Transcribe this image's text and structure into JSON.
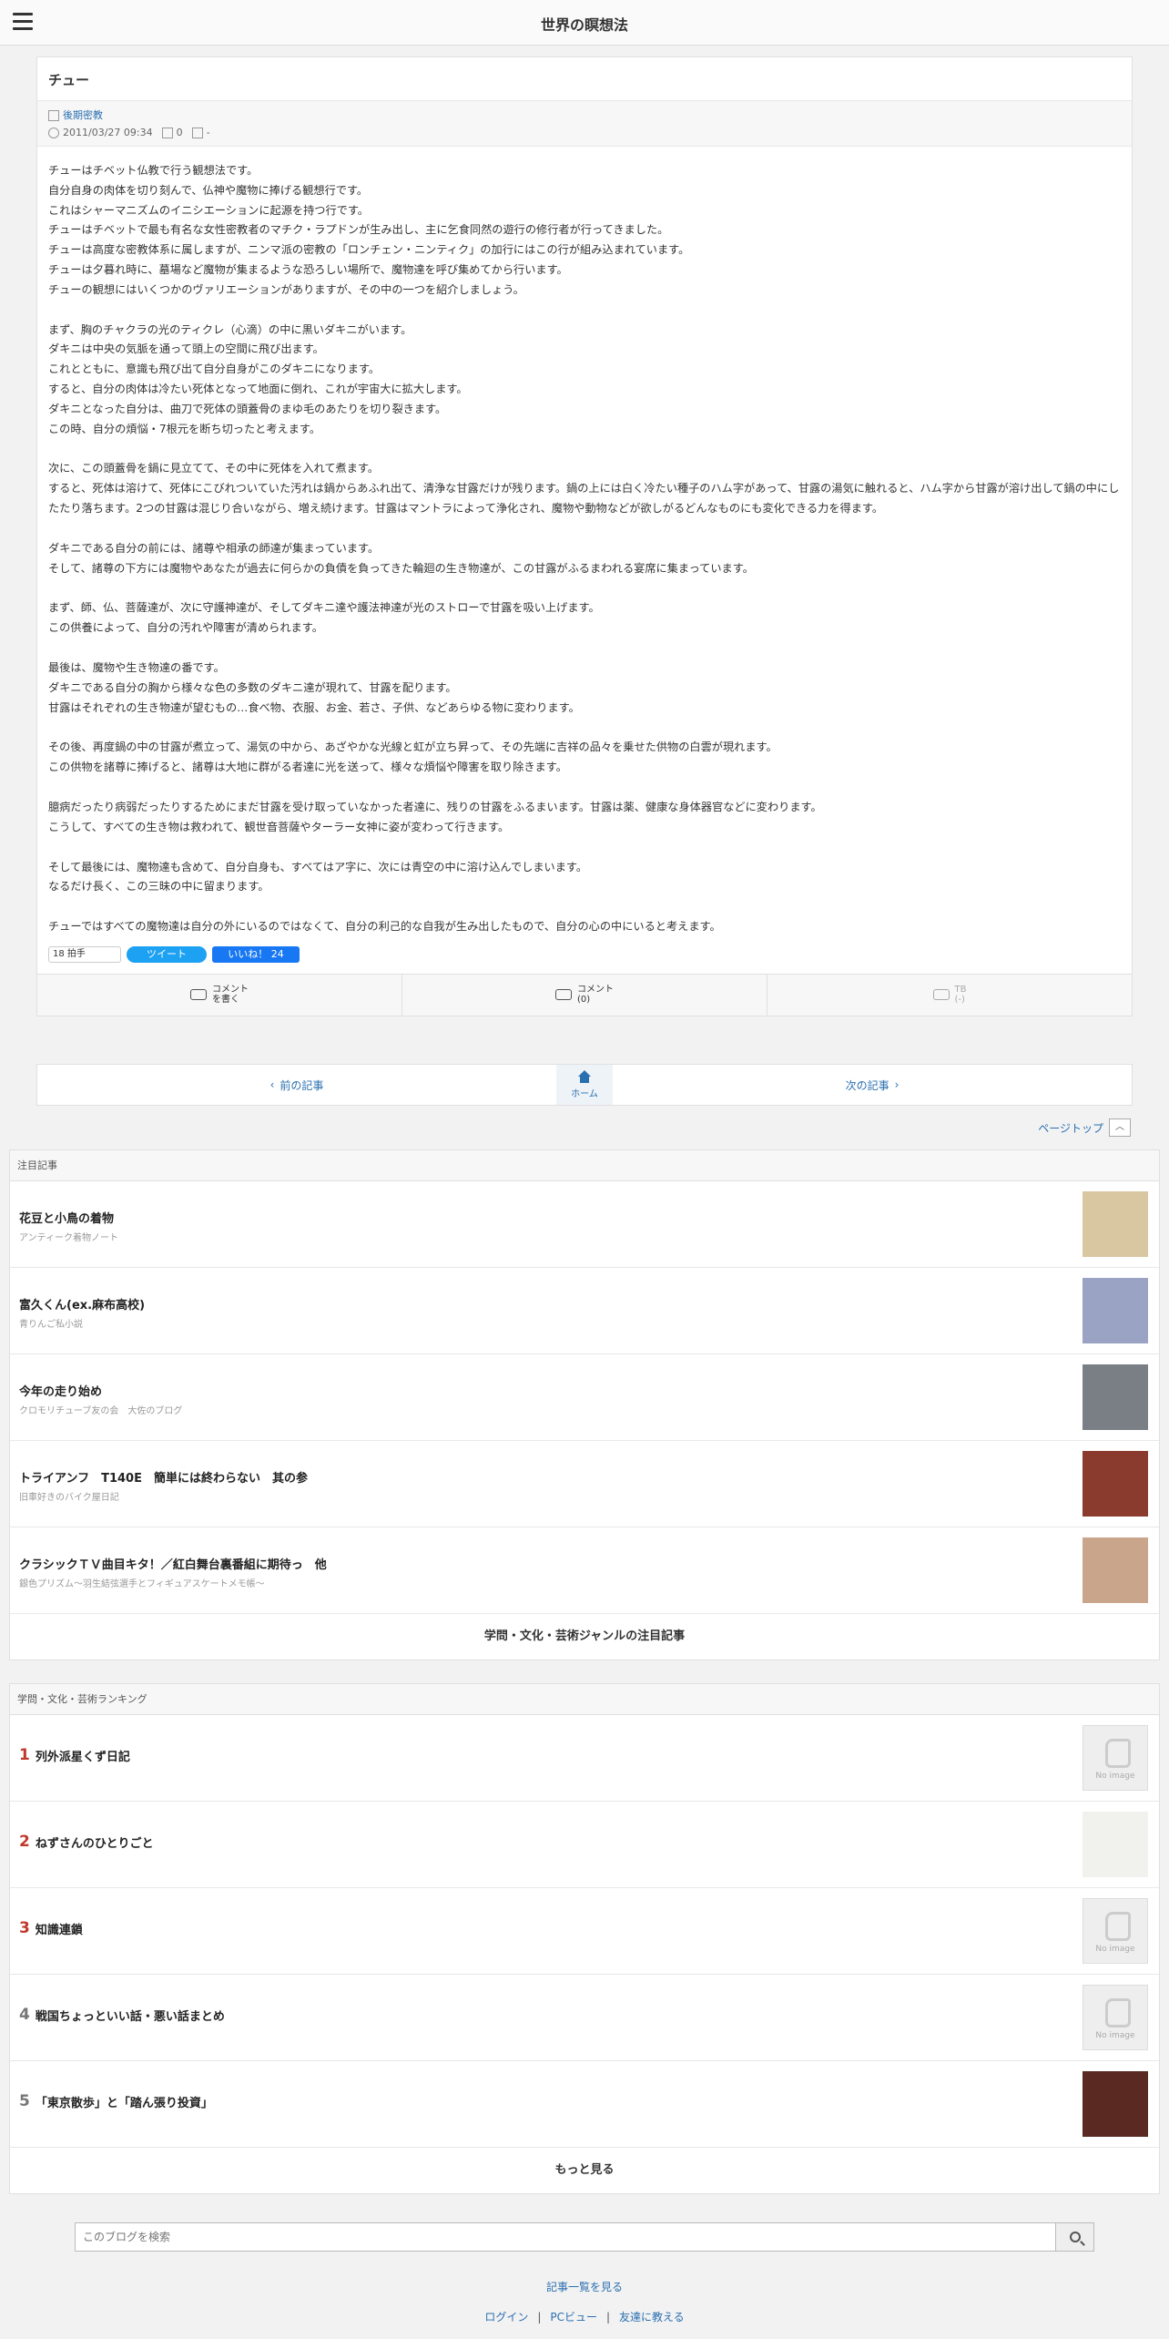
{
  "header": {
    "blog_title": "世界の瞑想法"
  },
  "article": {
    "title": "チュー",
    "category": "後期密教",
    "datetime": "2011/03/27 09:34",
    "comment_count": "0",
    "tb_count": "-",
    "paragraphs": [
      "チューはチベット仏教で行う観想法です。\n自分自身の肉体を切り刻んで、仏神や魔物に捧げる観想行です。\nこれはシャーマニズムのイニシエーションに起源を持つ行です。\nチューはチベットで最も有名な女性密教者のマチク・ラプドンが生み出し、主に乞食同然の遊行の修行者が行ってきました。\nチューは高度な密教体系に属しますが、ニンマ派の密教の「ロンチェン・ニンティク」の加行にはこの行が組み込まれています。\nチューは夕暮れ時に、墓場など魔物が集まるような恐ろしい場所で、魔物達を呼び集めてから行います。\nチューの観想にはいくつかのヴァリエーションがありますが、その中の一つを紹介しましょう。",
      "まず、胸のチャクラの光のティクレ（心滴）の中に黒いダキニがいます。\nダキニは中央の気脈を通って頭上の空間に飛び出ます。\nこれとともに、意識も飛び出て自分自身がこのダキニになります。\nすると、自分の肉体は冷たい死体となって地面に倒れ、これが宇宙大に拡大します。\nダキニとなった自分は、曲刀で死体の頭蓋骨のまゆ毛のあたりを切り裂きます。\nこの時、自分の煩悩・7根元を断ち切ったと考えます。",
      "次に、この頭蓋骨を鍋に見立てて、その中に死体を入れて煮ます。\nすると、死体は溶けて、死体にこびれついていた汚れは鍋からあふれ出て、清浄な甘露だけが残ります。鍋の上には白く冷たい種子のハム字があって、甘露の湯気に触れると、ハム字から甘露が溶け出して鍋の中にしたたり落ちます。2つの甘露は混じり合いながら、増え続けます。甘露はマントラによって浄化され、魔物や動物などが欲しがるどんなものにも変化できる力を得ます。",
      "ダキニである自分の前には、諸尊や相承の師達が集まっています。\nそして、諸尊の下方には魔物やあなたが過去に何らかの負債を負ってきた輪廻の生き物達が、この甘露がふるまわれる宴席に集まっています。",
      "まず、師、仏、菩薩達が、次に守護神達が、そしてダキニ達や護法神達が光のストローで甘露を吸い上げます。\nこの供養によって、自分の汚れや障害が清められます。",
      "最後は、魔物や生き物達の番です。\nダキニである自分の胸から様々な色の多数のダキニ達が現れて、甘露を配ります。\n甘露はそれぞれの生き物達が望むもの…食べ物、衣服、お金、若さ、子供、などあらゆる物に変わります。",
      "その後、再度鍋の中の甘露が煮立って、湯気の中から、あざやかな光線と虹が立ち昇って、その先端に吉祥の品々を乗せた供物の白雲が現れます。\nこの供物を諸尊に捧げると、諸尊は大地に群がる者達に光を送って、様々な煩悩や障害を取り除きます。",
      "臆病だったり病弱だったりするためにまだ甘露を受け取っていなかった者達に、残りの甘露をふるまいます。甘露は薬、健康な身体器官などに変わります。\nこうして、すべての生き物は救われて、観世音菩薩やターラー女神に姿が変わって行きます。",
      "そして最後には、魔物達も含めて、自分自身も、すべてはア字に、次には青空の中に溶け込んでしまいます。\nなるだけ長く、この三昧の中に留まります。",
      "チューではすべての魔物達は自分の外にいるのではなくて、自分の利己的な自我が生み出したもので、自分の心の中にいると考えます。"
    ]
  },
  "share": {
    "hatena_label": "18 拍手",
    "tweet_label": "ツイート",
    "like_label": "いいね！ 24"
  },
  "actions": {
    "write_comment": "コメント\nを書く",
    "comments": "コメント\n(0)",
    "tb": "TB\n(-)"
  },
  "pager": {
    "prev": "前の記事",
    "home": "ホーム",
    "next": "次の記事"
  },
  "pagetop": {
    "label": "ページトップ"
  },
  "featured": {
    "heading": "注目記事",
    "items": [
      {
        "title": "花豆と小鳥の着物",
        "blog": "アンティーク着物ノート",
        "thumb_color": "#d8c7a0"
      },
      {
        "title": "富久くん(ex.麻布高校)",
        "blog": "青りんご私小説",
        "thumb_color": "#9aa3c4"
      },
      {
        "title": "今年の走り始め",
        "blog": "クロモリチューブ友の会　大佐のブログ",
        "thumb_color": "#7a7f86"
      },
      {
        "title": "トライアンフ　T140E　簡単には終わらない　其の参",
        "blog": "旧車好きのバイク屋日記",
        "thumb_color": "#8a3b2e"
      },
      {
        "title": "クラシックＴＶ曲目キタ！／紅白舞台裏番組に期待っ　他",
        "blog": "銀色プリズム～羽生結弦選手とフィギュアスケートメモ帳～",
        "thumb_color": "#c9a58c"
      }
    ],
    "footer": "学問・文化・芸術ジャンルの注目記事"
  },
  "ranking": {
    "heading": "学問・文化・芸術ランキング",
    "items": [
      {
        "rank": "1",
        "title": "列外派星くず日記",
        "no_image": "No image",
        "rank_color": "#c0392b"
      },
      {
        "rank": "2",
        "title": "ねずさんのひとりごと",
        "no_image": "",
        "rank_color": "#c0392b"
      },
      {
        "rank": "3",
        "title": "知識連鎖",
        "no_image": "No image",
        "rank_color": "#c0392b"
      },
      {
        "rank": "4",
        "title": "戦国ちょっといい話・悪い話まとめ",
        "no_image": "No image",
        "rank_color": "#777777"
      },
      {
        "rank": "5",
        "title": "「東京散歩」と「踏ん張り投資」",
        "no_image": "",
        "rank_color": "#777777"
      }
    ],
    "footer": "もっと見る"
  },
  "search": {
    "placeholder": "このブログを検索"
  },
  "footer": {
    "article_list": "記事一覧を見る",
    "login": "ログイン",
    "pc_view": "PCビュー",
    "tell_friend": "友達に教える"
  },
  "colors": {
    "link": "#2a6fb0",
    "accent_rank": "#c0392b"
  }
}
